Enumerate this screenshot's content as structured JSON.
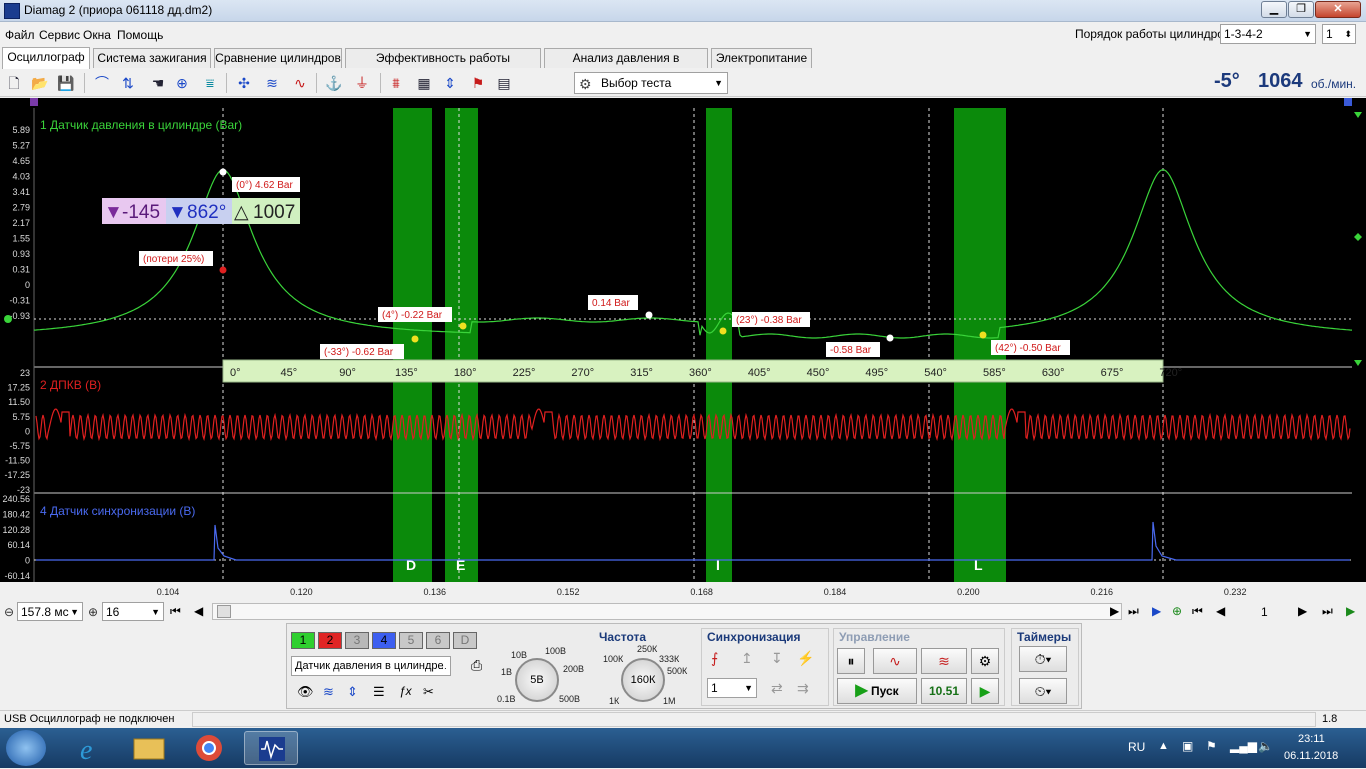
{
  "window": {
    "title": "Diamag 2 (приора 061118 дд.dm2)",
    "minimize_label": "▁",
    "maximize_label": "❐",
    "close_label": "✕"
  },
  "menu": {
    "items": [
      "Файл",
      "Сервис",
      "Окна",
      "Помощь"
    ]
  },
  "firing_order": {
    "label": "Порядок работы цилиндров",
    "value": "1-3-4-2",
    "cylinder": "1"
  },
  "tabs": [
    "Осциллограф",
    "Система зажигания",
    "Сравнение цилиндров",
    "Эффективность работы цилиндров",
    "Анализ давления в цилиндре",
    "Электропитание"
  ],
  "toolbar": {
    "test_select_label": "Выбор теста",
    "angle": "-5°",
    "rpm": "1064",
    "rpm_unit": "об./мин.",
    "icons": [
      "new-file-icon",
      "open-folder-icon",
      "save-icon",
      "loop-icon",
      "cursor-icon",
      "hand-icon",
      "zoom-icon",
      "filter-icon",
      "signal-icon",
      "noise-icon",
      "waves-icon",
      "auto-icon",
      "zero-icon",
      "grid-icon",
      "table-icon",
      "split-icon",
      "flag-icon",
      "doc-icon"
    ]
  },
  "scope": {
    "channel1": {
      "label": "1 Датчик давления в цилиндре (Bar)",
      "color": "#3ad43a",
      "y_ticks": [
        "5.89",
        "5.27",
        "4.65",
        "4.03",
        "3.41",
        "2.79",
        "2.17",
        "1.55",
        "0.93",
        "0.31",
        "0",
        "-0.31",
        "-0.93"
      ],
      "annotations": [
        {
          "text": "(0°) 4.62 Bar"
        },
        {
          "text": "(потери 25%)"
        },
        {
          "text": "(4°) -0.22 Bar"
        },
        {
          "text": "(-33°) -0.62 Bar"
        },
        {
          "text": "0.14 Bar"
        },
        {
          "text": "(23°) -0.38 Bar"
        },
        {
          "text": "-0.58 Bar"
        },
        {
          "text": "(42°) -0.50 Bar"
        }
      ]
    },
    "cursor_box": {
      "a": "-145",
      "b": "862°",
      "delta": "1007"
    },
    "angle_ruler": [
      "0°",
      "45°",
      "90°",
      "135°",
      "180°",
      "225°",
      "270°",
      "315°",
      "360°",
      "405°",
      "450°",
      "495°",
      "540°",
      "585°",
      "630°",
      "675°",
      "720°"
    ],
    "channel2": {
      "label": "2 ДПКВ (В)",
      "color": "#e02020",
      "y_ticks": [
        "23",
        "17.25",
        "11.50",
        "5.75",
        "0",
        "-5.75",
        "-11.50",
        "-17.25",
        "-23"
      ]
    },
    "channel4": {
      "label": "4 Датчик синхронизации (В)",
      "color": "#4a6af0",
      "y_ticks": [
        "240.56",
        "180.42",
        "120.28",
        "60.14",
        "0",
        "-60.14"
      ]
    },
    "zones": [
      "D",
      "E",
      "I",
      "L"
    ],
    "time_axis": [
      "0.104",
      "0.120",
      "0.136",
      "0.152",
      "0.168",
      "0.184",
      "0.200",
      "0.216",
      "0.232"
    ]
  },
  "bottom_bar": {
    "timebase": "157.8 мс",
    "count": "16",
    "page": "1"
  },
  "control": {
    "channels": [
      "1",
      "2",
      "3",
      "4",
      "5",
      "6",
      "D"
    ],
    "channel_colors": [
      "#2fcf2f",
      "#e02525",
      "#b8b8b8",
      "#3d5ff0",
      "#c8c8c8",
      "#c8c8c8",
      "#c8c8c8"
    ],
    "sensor_select": "Датчик давления в цилиндре",
    "volt_knob": "5В",
    "volt_ticks": [
      "10В",
      "100В",
      "1В",
      "200В",
      "0.1В",
      "500В"
    ],
    "freq_title": "Частота",
    "freq_knob": "160К",
    "freq_ticks": [
      "250К",
      "100К",
      "333К",
      "500К",
      "1К",
      "1М"
    ],
    "sync_title": "Синхронизация",
    "sync_value": "1",
    "mgmt_title": "Управление",
    "start_label": "Пуск",
    "value_display": "10.51",
    "timers_title": "Таймеры"
  },
  "status": {
    "left": "USB Осциллограф не подключен",
    "right": "1.8"
  },
  "taskbar": {
    "lang": "RU",
    "time": "23:11",
    "date": "06.11.2018"
  }
}
